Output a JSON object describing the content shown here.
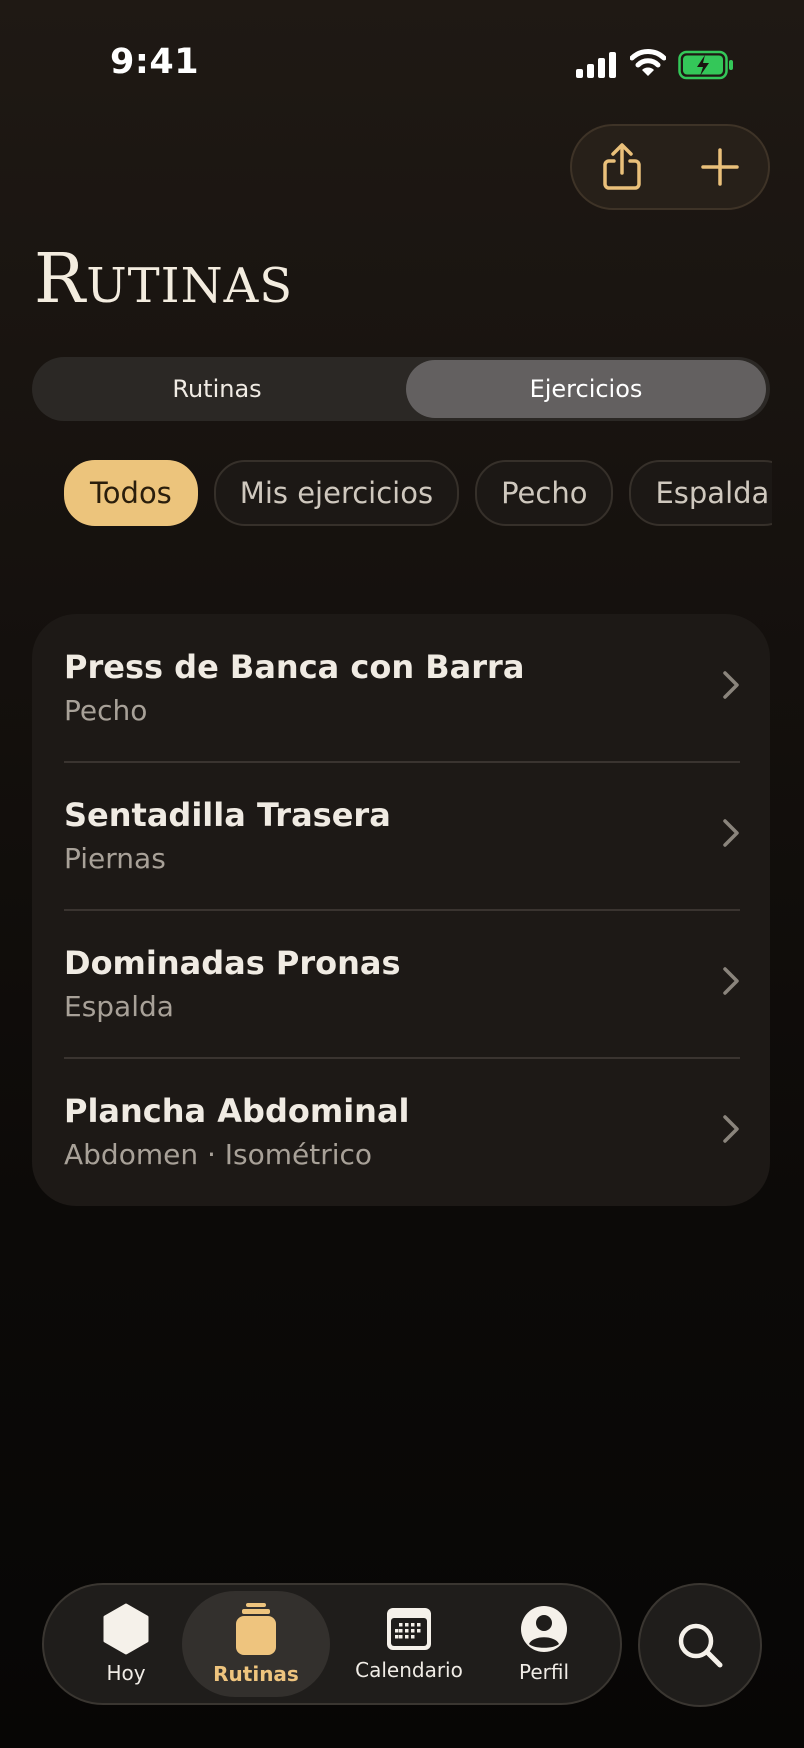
{
  "status_bar": {
    "time": "9:41"
  },
  "header": {
    "title": "Rutinas"
  },
  "segmented": {
    "options": [
      "Rutinas",
      "Ejercicios"
    ],
    "selected": "Ejercicios"
  },
  "filters": {
    "chips": [
      "Todos",
      "Mis ejercicios",
      "Pecho",
      "Espalda"
    ],
    "selected": "Todos"
  },
  "exercises": [
    {
      "name": "Press de Banca con Barra",
      "detail": "Pecho"
    },
    {
      "name": "Sentadilla Trasera",
      "detail": "Piernas"
    },
    {
      "name": "Dominadas Pronas",
      "detail": "Espalda"
    },
    {
      "name": "Plancha Abdominal",
      "detail": "Abdomen · Isométrico"
    }
  ],
  "tabbar": {
    "items": [
      {
        "label": "Hoy",
        "icon": "hexagon-icon"
      },
      {
        "label": "Rutinas",
        "icon": "jar-icon"
      },
      {
        "label": "Calendario",
        "icon": "calendar-icon"
      },
      {
        "label": "Perfil",
        "icon": "profile-icon"
      }
    ],
    "active": "Rutinas"
  },
  "colors": {
    "accent": "#ECC47C",
    "background": "#14100D",
    "card": "#1D1916",
    "battery": "#34C759"
  }
}
